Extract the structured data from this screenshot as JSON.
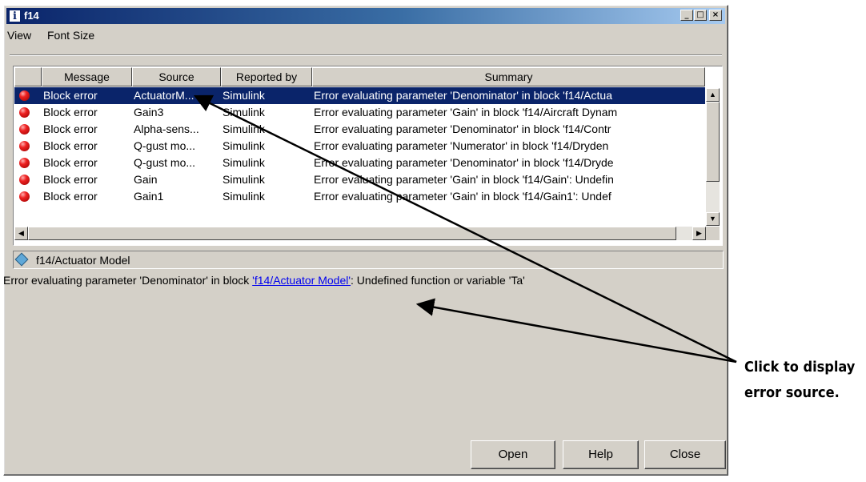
{
  "window": {
    "title": "f14",
    "title_icon": "i",
    "controls": [
      "_",
      "□",
      "×"
    ]
  },
  "menu": [
    "View",
    "Font Size"
  ],
  "table": {
    "columns": [
      "Message",
      "Source",
      "Reported by",
      "Summary"
    ],
    "rows": [
      {
        "message": "Block error",
        "source": "ActuatorM...",
        "reported_by": "Simulink",
        "summary": "Error evaluating parameter 'Denominator' in block 'f14/Actua",
        "selected": true
      },
      {
        "message": "Block error",
        "source": "Gain3",
        "reported_by": "Simulink",
        "summary": "Error evaluating parameter 'Gain' in block 'f14/Aircraft Dynam",
        "selected": false
      },
      {
        "message": "Block error",
        "source": "Alpha-sens...",
        "reported_by": "Simulink",
        "summary": "Error evaluating parameter 'Denominator' in block 'f14/Contr",
        "selected": false
      },
      {
        "message": "Block error",
        "source": "Q-gust mo...",
        "reported_by": "Simulink",
        "summary": "Error evaluating parameter 'Numerator' in block 'f14/Dryden",
        "selected": false
      },
      {
        "message": "Block error",
        "source": "Q-gust mo...",
        "reported_by": "Simulink",
        "summary": "Error evaluating parameter 'Denominator' in block 'f14/Dryde",
        "selected": false
      },
      {
        "message": "Block error",
        "source": "Gain",
        "reported_by": "Simulink",
        "summary": "Error evaluating parameter 'Gain' in block 'f14/Gain': Undefin",
        "selected": false
      },
      {
        "message": "Block error",
        "source": "Gain1",
        "reported_by": "Simulink",
        "summary": "Error evaluating parameter 'Gain' in block 'f14/Gain1': Undef",
        "selected": false
      }
    ]
  },
  "detail": {
    "path": "f14/Actuator Model",
    "message_prefix": "Error evaluating parameter 'Denominator' in block ",
    "message_link": "'f14/Actuator Model'",
    "message_suffix": ": Undefined function or variable 'Ta'"
  },
  "buttons": {
    "open": "Open",
    "help": "Help",
    "close": "Close"
  },
  "callout": {
    "line1": "Click to display",
    "line2": "error source."
  },
  "colors": {
    "selection": "#0a246a",
    "link": "#0000ee",
    "error_dot": "#ee2222"
  }
}
